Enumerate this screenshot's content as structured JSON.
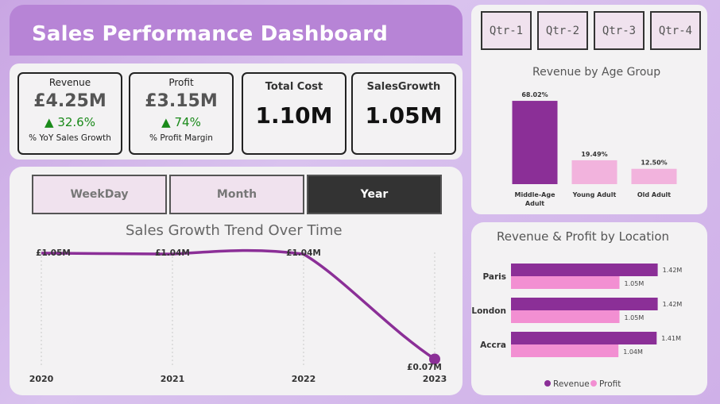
{
  "header": {
    "title": "Sales Performance Dashboard"
  },
  "kpis": [
    {
      "label": "Revenue",
      "value": "£4.25M",
      "delta": "▲ 32.6%",
      "sub": "% YoY Sales Growth"
    },
    {
      "label": "Profit",
      "value": "£3.15M",
      "delta": "▲ 74%",
      "sub": "% Profit Margin"
    },
    {
      "label": "Total Cost",
      "value": "1.10M"
    },
    {
      "label": "SalesGrowth",
      "value": "1.05M"
    }
  ],
  "period_slicer": {
    "options": [
      "WeekDay",
      "Month",
      "Year"
    ],
    "selected": "Year"
  },
  "quarter_slicer": {
    "options": [
      "Qtr-1",
      "Qtr-2",
      "Qtr-3",
      "Qtr-4"
    ]
  },
  "colors": {
    "primary": "#8b2f97",
    "secondary": "#f28fd2",
    "light_bar": "#f2b3dd"
  },
  "chart_data": [
    {
      "type": "line",
      "title": "Sales Growth Trend Over Time",
      "x": [
        "2020",
        "2021",
        "2022",
        "2023"
      ],
      "series": [
        {
          "values": [
            1.05,
            1.04,
            1.04,
            0.07
          ]
        }
      ],
      "data_labels": [
        "£1.05M",
        "£1.04M",
        "£1.04M",
        "£0.07M"
      ],
      "ylim": [
        0,
        1.1
      ],
      "grid": true
    },
    {
      "type": "bar",
      "title": "Revenue by Age Group",
      "categories": [
        "Middle-Age Adult",
        "Young Adult",
        "Old Adult"
      ],
      "values": [
        68.02,
        19.49,
        12.5
      ],
      "data_labels": [
        "68.02%",
        "19.49%",
        "12.50%"
      ],
      "ylim": [
        0,
        70
      ]
    },
    {
      "type": "bar",
      "orientation": "horizontal",
      "title": "Revenue & Profit by Location",
      "categories": [
        "Paris",
        "London",
        "Accra"
      ],
      "series": [
        {
          "name": "Revenue",
          "values": [
            1.42,
            1.42,
            1.41
          ],
          "labels": [
            "1.42M",
            "1.42M",
            "1.41M"
          ]
        },
        {
          "name": "Profit",
          "values": [
            1.05,
            1.05,
            1.04
          ],
          "labels": [
            "1.05M",
            "1.05M",
            "1.04M"
          ]
        }
      ],
      "xlim": [
        0,
        1.6
      ],
      "legend": "bottom"
    }
  ]
}
